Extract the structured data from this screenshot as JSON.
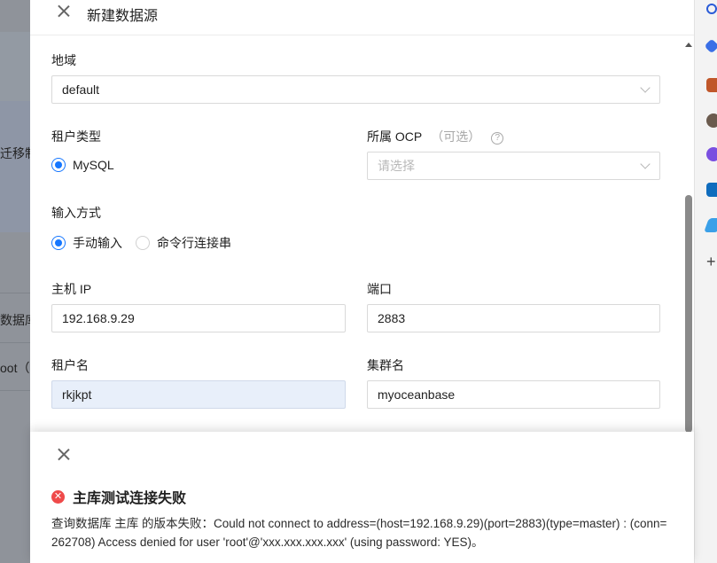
{
  "background": {
    "partial_texts": [
      "迁移制",
      "数据库",
      "oot（"
    ]
  },
  "drawer": {
    "title": "新建数据源",
    "region": {
      "label": "地域",
      "value": "default"
    },
    "tenant_type": {
      "label": "租户类型",
      "option": "MySQL"
    },
    "ocp": {
      "label": "所属 OCP",
      "optional": "（可选）",
      "help": "?",
      "placeholder": "请选择"
    },
    "input_mode": {
      "label": "输入方式",
      "options": [
        "手动输入",
        "命令行连接串"
      ]
    },
    "host_ip": {
      "label": "主机 IP",
      "value": "192.168.9.29"
    },
    "port": {
      "label": "端口",
      "value": "2883"
    },
    "tenant_name": {
      "label": "租户名",
      "value": "rkjkpt"
    },
    "cluster_name": {
      "label": "集群名",
      "value": "myoceanbase"
    }
  },
  "notification": {
    "icon": "error-icon",
    "title": "主库测试连接失败",
    "message": "查询数据库 主库 的版本失败：Could not connect to address=(host=192.168.9.29)(port=2883)(type=master) : (conn=262708) Access denied for user 'root'@'xxx.xxx.xxx.xxx' (using password: YES)。"
  },
  "colors": {
    "primary": "#1677ff",
    "error": "#ef4a4a",
    "autofill": "#e8effa"
  }
}
